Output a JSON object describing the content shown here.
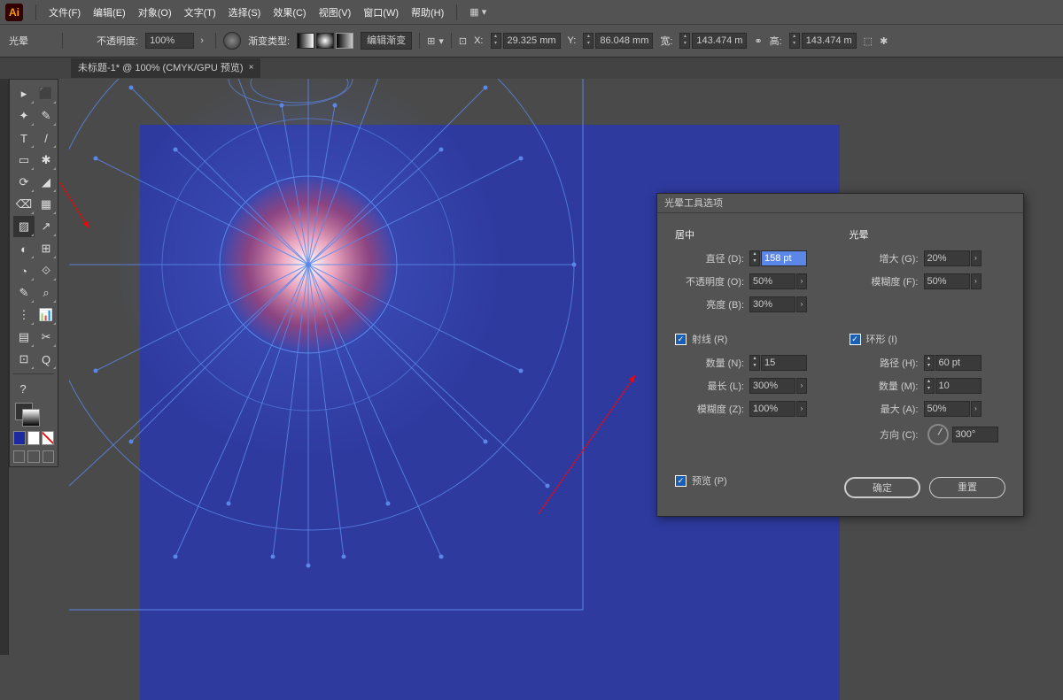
{
  "app": {
    "logo": "Ai"
  },
  "menu": [
    "文件(F)",
    "编辑(E)",
    "对象(O)",
    "文字(T)",
    "选择(S)",
    "效果(C)",
    "视图(V)",
    "窗口(W)",
    "帮助(H)"
  ],
  "controlbar": {
    "object_name": "光晕",
    "opacity_label": "不透明度:",
    "opacity_value": "100%",
    "gradient_type_label": "渐变类型:",
    "edit_gradient": "编辑渐变",
    "x_label": "X:",
    "x_value": "29.325 mm",
    "y_label": "Y:",
    "y_value": "86.048 mm",
    "w_label": "宽:",
    "w_value": "143.474 m",
    "h_label": "高:",
    "h_value": "143.474 m"
  },
  "tab": {
    "title": "未标题-1* @ 100% (CMYK/GPU 预览)"
  },
  "dialog": {
    "title": "光晕工具选项",
    "center_section": "居中",
    "diameter_label": "直径 (D):",
    "diameter_value": "158 pt",
    "opacity_label": "不透明度 (O):",
    "opacity_value": "50%",
    "brightness_label": "亮度 (B):",
    "brightness_value": "30%",
    "halo_section": "光晕",
    "growth_label": "增大 (G):",
    "growth_value": "20%",
    "fuzz_label": "模糊度 (F):",
    "fuzz_value": "50%",
    "rays_check": "射线 (R)",
    "rays_count_label": "数量 (N):",
    "rays_count_value": "15",
    "rays_longest_label": "最长 (L):",
    "rays_longest_value": "300%",
    "rays_fuzz_label": "模糊度 (Z):",
    "rays_fuzz_value": "100%",
    "rings_check": "环形 (I)",
    "rings_path_label": "路径 (H):",
    "rings_path_value": "60 pt",
    "rings_count_label": "数量 (M):",
    "rings_count_value": "10",
    "rings_largest_label": "最大 (A):",
    "rings_largest_value": "50%",
    "rings_dir_label": "方向 (C):",
    "rings_dir_value": "300°",
    "preview": "预览 (P)",
    "ok": "确定",
    "reset": "重置"
  },
  "tools": [
    "▸",
    "⬛",
    "✦",
    "✎",
    "T",
    "/",
    "▭",
    "✱",
    "⟳",
    "◢",
    "⌫",
    "▦",
    "▨",
    "↗",
    "◐",
    "⊞",
    "◔",
    "⟐",
    "✎",
    "⌕",
    "⋮",
    "📊",
    "▤",
    "✂",
    "⊡",
    "Q"
  ]
}
